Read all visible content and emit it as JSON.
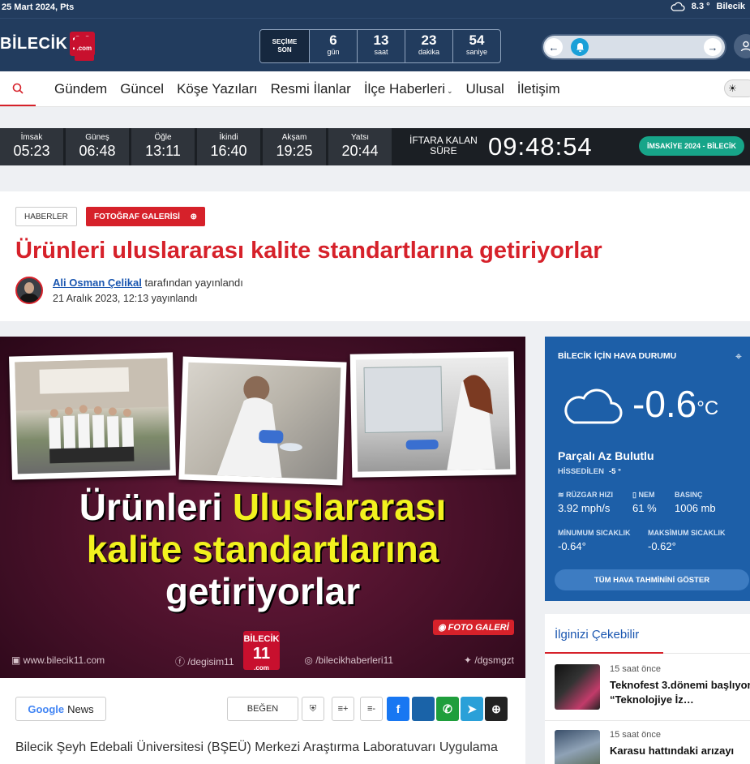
{
  "topbar": {
    "date": "25 Mart 2024, Pts",
    "temp": "8.3 °",
    "city": "Bilecik"
  },
  "brand": {
    "word": "BİLECİK",
    "number": "11",
    "suffix": ".com"
  },
  "countdown": {
    "label_line1": "SEÇİME",
    "label_line2": "SON",
    "cells": [
      {
        "value": "6",
        "unit": "gün"
      },
      {
        "value": "13",
        "unit": "saat"
      },
      {
        "value": "23",
        "unit": "dakika"
      },
      {
        "value": "54",
        "unit": "saniye"
      }
    ]
  },
  "nav": {
    "items": [
      "Gündem",
      "Güncel",
      "Köşe Yazıları",
      "Resmi İlanlar",
      "İlçe Haberleri",
      "Ulusal",
      "İletişim"
    ]
  },
  "prayer": {
    "times": [
      {
        "name": "İmsak",
        "time": "05:23"
      },
      {
        "name": "Güneş",
        "time": "06:48"
      },
      {
        "name": "Öğle",
        "time": "13:11"
      },
      {
        "name": "İkindi",
        "time": "16:40"
      },
      {
        "name": "Akşam",
        "time": "19:25"
      },
      {
        "name": "Yatsı",
        "time": "20:44"
      }
    ],
    "iftar_line1": "İFTARA KALAN",
    "iftar_line2": "SÜRE",
    "clock": "09:48:54",
    "imsakiye": "İMSAKİYE 2024 - BİLECİK"
  },
  "article": {
    "category": "HABERLER",
    "gallery": "FOTOĞRAF GALERİSİ",
    "title": "Ürünleri uluslararası kalite standartlarına getiriyorlar",
    "author": "Ali Osman Çelikal",
    "author_suffix": "tarafından yayınlandı",
    "published": "21 Aralık 2023, 12:13 yayınlandı",
    "hero": {
      "line1_a": "Ürünleri ",
      "line1_b": "Uluslararası",
      "line2": "kalite standartlarına",
      "line3": "getiriyorlar",
      "badge": "FOTO GALERİ",
      "logo_word": "BİLECİK",
      "logo_num": "11",
      "logo_suffix": ".com",
      "footer": [
        "www.bilecik11.com",
        "/degisim11",
        "/bilecikhaberleri11",
        "/dgsmgzt"
      ]
    },
    "google_news_g": "Google",
    "google_news_n": "News",
    "like": "BEĞEN",
    "lead": "Bilecik Şeyh Edebali Üniversitesi (BŞEÜ) Merkezi Araştırma Laboratuvarı Uygulama"
  },
  "weather": {
    "header": "BİLECİK İÇİN HAVA DURUMU",
    "temp": "-0.6",
    "unit": "°C",
    "condition": "Parçalı Az Bulutlu",
    "feels_label": "HİSSEDİLEN",
    "feels_value": "-5 °",
    "wind_label": "RÜZGAR HIZI",
    "wind_value": "3.92 mph/s",
    "humidity_label": "NEM",
    "humidity_value": "61 %",
    "pressure_label": "BASINÇ",
    "pressure_value": "1006 mb",
    "min_label": "MİNUMUM SICAKLIK",
    "min_value": "-0.64°",
    "max_label": "MAKSİMUM SICAKLIK",
    "max_value": "-0.62°",
    "all_button": "TÜM HAVA TAHMİNİNİ GÖSTER"
  },
  "interest": {
    "heading": "İlginizi Çekebilir",
    "items": [
      {
        "ago": "15 saat önce",
        "title": "Teknofest 3.dönemi başlıyor “Teknolojiye İz…"
      },
      {
        "ago": "15 saat önce",
        "title": "Karasu hattındaki arızayı"
      }
    ]
  },
  "colors": {
    "brand_red": "#d6212a",
    "header_navy": "#223c5e",
    "weather_blue": "#1d5fa8",
    "teal": "#17a589"
  }
}
